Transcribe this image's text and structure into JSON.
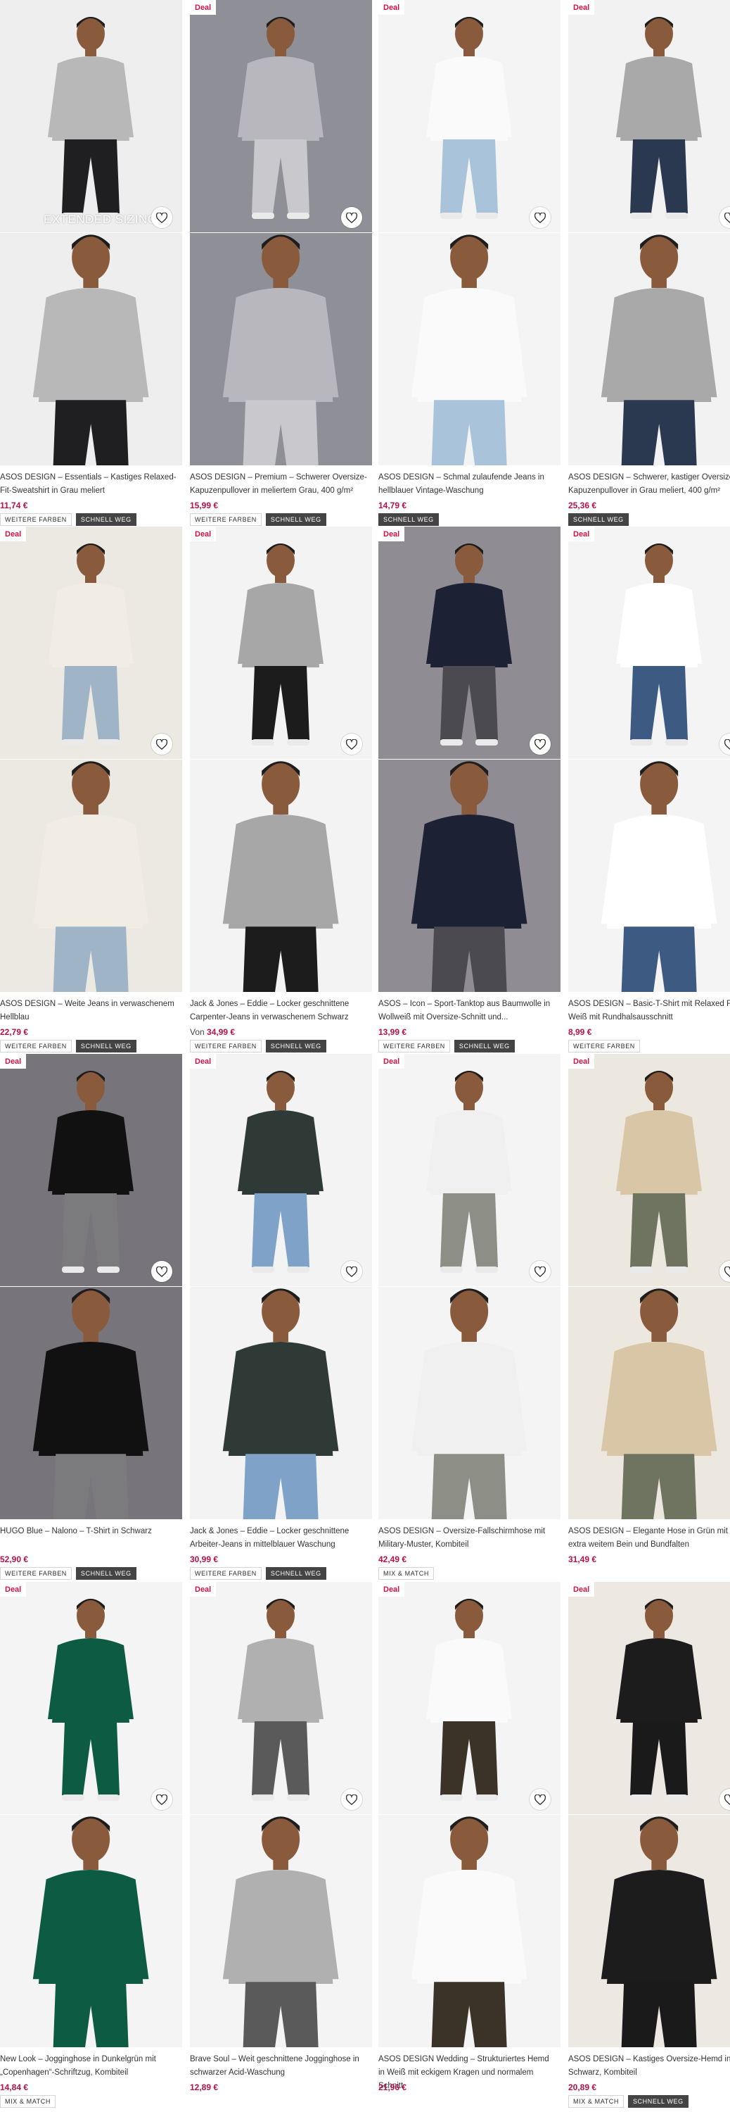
{
  "accent": "#d01345",
  "price_color": "#b7114a",
  "products": [
    {
      "badge": "",
      "overlay": "EXTENDED SIZING",
      "title": "ASOS DESIGN – Essentials – Kastiges Relaxed-Fit-Sweatshirt in Grau meliert",
      "price_prefix": "",
      "price": "11,74 €",
      "tags": [
        "WEITERE FARBEN",
        "SCHNELL WEG"
      ],
      "colors": {
        "bg": "#eeeeee",
        "top": "#b8b8b8",
        "bottom": "#1f1f22"
      }
    },
    {
      "badge": "Deal",
      "overlay": "",
      "title": "ASOS DESIGN – Premium – Schwerer Oversize-Kapuzenpullover in meliertem Grau, 400 g/m²",
      "price_prefix": "",
      "price": "15,99 €",
      "tags": [
        "WEITERE FARBEN",
        "SCHNELL WEG"
      ],
      "colors": {
        "bg": "#8f8f97",
        "top": "#b7b7bd",
        "bottom": "#c9c9cd"
      }
    },
    {
      "badge": "Deal",
      "overlay": "",
      "title": "ASOS DESIGN – Schmal zulaufende Jeans in hellblauer Vintage-Waschung",
      "price_prefix": "",
      "price": "14,79 €",
      "tags": [
        "SCHNELL WEG"
      ],
      "colors": {
        "bg": "#f4f4f4",
        "top": "#fafafa",
        "bottom": "#a9c3da"
      }
    },
    {
      "badge": "Deal",
      "overlay": "",
      "title": "ASOS DESIGN – Schwerer, kastiger Oversize-Kapuzenpullover in Grau meliert, 400 g/m²",
      "price_prefix": "",
      "price": "25,36 €",
      "tags": [
        "SCHNELL WEG"
      ],
      "colors": {
        "bg": "#f2f2f2",
        "top": "#a9a9a9",
        "bottom": "#2a3850"
      }
    },
    {
      "badge": "Deal",
      "overlay": "",
      "title": "ASOS DESIGN – Weite Jeans in verwaschenem Hellblau",
      "price_prefix": "",
      "price": "22,79 €",
      "tags": [
        "WEITERE FARBEN",
        "SCHNELL WEG"
      ],
      "colors": {
        "bg": "#ece8e2",
        "top": "#f1ede4",
        "bottom": "#9fb4c6"
      }
    },
    {
      "badge": "Deal",
      "overlay": "",
      "title": "Jack & Jones – Eddie – Locker geschnittene Carpenter-Jeans in verwaschenem Schwarz",
      "price_prefix": "Von ",
      "price": "34,99 €",
      "tags": [
        "WEITERE FARBEN",
        "SCHNELL WEG"
      ],
      "colors": {
        "bg": "#f3f3f3",
        "top": "#a7a7a7",
        "bottom": "#1c1c1c"
      }
    },
    {
      "badge": "Deal",
      "overlay": "",
      "title": "ASOS – Icon – Sport-Tanktop aus Baumwolle in Wollweiß mit Oversize-Schnitt und...",
      "price_prefix": "",
      "price": "13,99 €",
      "tags": [
        "WEITERE FARBEN",
        "SCHNELL WEG"
      ],
      "colors": {
        "bg": "#8f8c93",
        "top": "#1c2233",
        "bottom": "#4a4a50"
      }
    },
    {
      "badge": "Deal",
      "overlay": "",
      "title": "ASOS DESIGN – Basic-T-Shirt mit Relaxed Fit in Weiß mit Rundhalsausschnitt",
      "price_prefix": "",
      "price": "8,99 €",
      "tags": [
        "WEITERE FARBEN"
      ],
      "colors": {
        "bg": "#f4f4f4",
        "top": "#ffffff",
        "bottom": "#3c5a82"
      }
    },
    {
      "badge": "Deal",
      "overlay": "",
      "title": "HUGO Blue – Nalono – T-Shirt in Schwarz",
      "price_prefix": "",
      "price": "52,90 €",
      "tags": [
        "WEITERE FARBEN",
        "SCHNELL WEG"
      ],
      "colors": {
        "bg": "#77747c",
        "top": "#111111",
        "bottom": "#7b7b7d"
      }
    },
    {
      "badge": "Deal",
      "overlay": "",
      "title": "Jack & Jones – Eddie – Locker geschnittene Arbeiter-Jeans in mittelblauer Waschung",
      "price_prefix": "",
      "price": "30,99 €",
      "tags": [
        "WEITERE FARBEN",
        "SCHNELL WEG"
      ],
      "colors": {
        "bg": "#f3f3f3",
        "top": "#2f3a36",
        "bottom": "#7fa2c9"
      }
    },
    {
      "badge": "Deal",
      "overlay": "",
      "title": "ASOS DESIGN – Oversize-Fallschirmhose mit Military-Muster, Kombiteil",
      "price_prefix": "",
      "price": "42,49 €",
      "tags": [
        "MIX & MATCH"
      ],
      "colors": {
        "bg": "#f4f4f4",
        "top": "#f0f0f0",
        "bottom": "#8d8f86"
      }
    },
    {
      "badge": "Deal",
      "overlay": "",
      "title": "ASOS DESIGN – Elegante Hose in Grün mit extra weitem Bein und Bundfalten",
      "price_prefix": "",
      "price": "31,49 €",
      "tags": [],
      "colors": {
        "bg": "#ece7df",
        "top": "#d8c6a6",
        "bottom": "#6f7460"
      }
    },
    {
      "badge": "Deal",
      "overlay": "",
      "title": "New Look – Jogginghose in Dunkelgrün mit „Copenhagen“-Schriftzug, Kombiteil",
      "price_prefix": "",
      "price": "14,84 €",
      "tags": [
        "MIX & MATCH"
      ],
      "colors": {
        "bg": "#f4f4f4",
        "top": "#0e5b43",
        "bottom": "#0e5b43"
      }
    },
    {
      "badge": "Deal",
      "overlay": "",
      "title": "Brave Soul – Weit geschnittene Jogginghose in schwarzer Acid-Waschung",
      "price_prefix": "",
      "price": "12,89 €",
      "tags": [],
      "colors": {
        "bg": "#f4f4f4",
        "top": "#b0b0b0",
        "bottom": "#5a5a5a"
      }
    },
    {
      "badge": "Deal",
      "overlay": "",
      "title": "ASOS DESIGN Wedding – Strukturiertes Hemd in Weiß mit eckigem Kragen und normalem Schnitt",
      "price_prefix": "",
      "price": "21,96 €",
      "tags": [],
      "colors": {
        "bg": "#f4f4f4",
        "top": "#fafafa",
        "bottom": "#3b3328"
      }
    },
    {
      "badge": "Deal",
      "overlay": "",
      "title": "ASOS DESIGN – Kastiges Oversize-Hemd in Schwarz, Kombiteil",
      "price_prefix": "",
      "price": "20,89 €",
      "tags": [
        "MIX & MATCH",
        "SCHNELL WEG"
      ],
      "colors": {
        "bg": "#ede8e1",
        "top": "#1c1c1c",
        "bottom": "#1a1a1a"
      }
    }
  ]
}
